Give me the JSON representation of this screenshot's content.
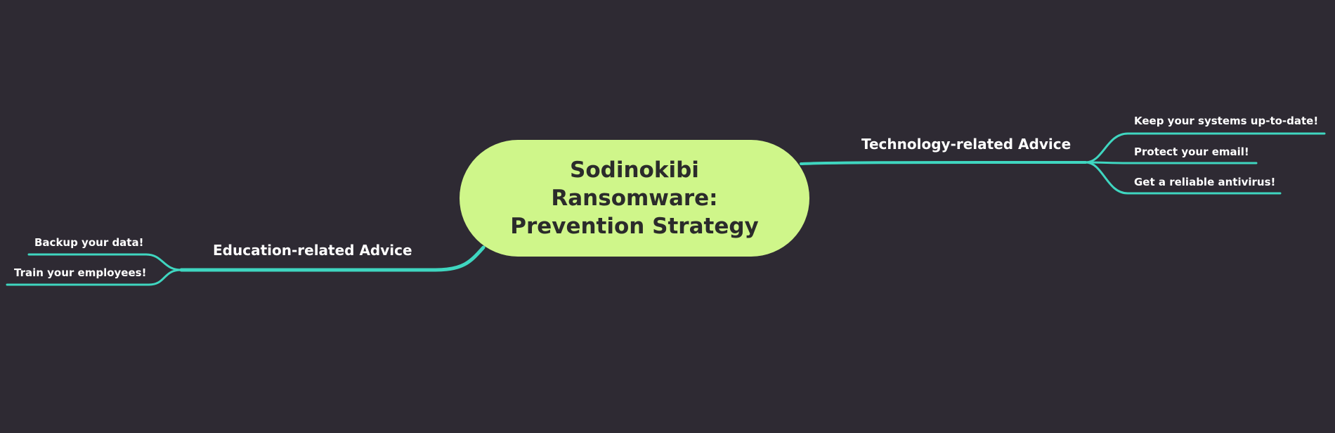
{
  "mindmap": {
    "central_topic": "Sodinokibi\nRansomware:\nPrevention Strategy",
    "branches": [
      {
        "label": "Technology-related Advice",
        "children": [
          "Keep your systems up-to-date!",
          "Protect your email!",
          "Get a reliable antivirus!"
        ]
      },
      {
        "label": "Education-related Advice",
        "children": [
          "Backup your data!",
          "Train your employees!"
        ]
      }
    ]
  },
  "colors": {
    "background": "#2e2a33",
    "central_fill": "#cff68a",
    "connector": "#3fd6c0",
    "text": "#ffffff"
  }
}
